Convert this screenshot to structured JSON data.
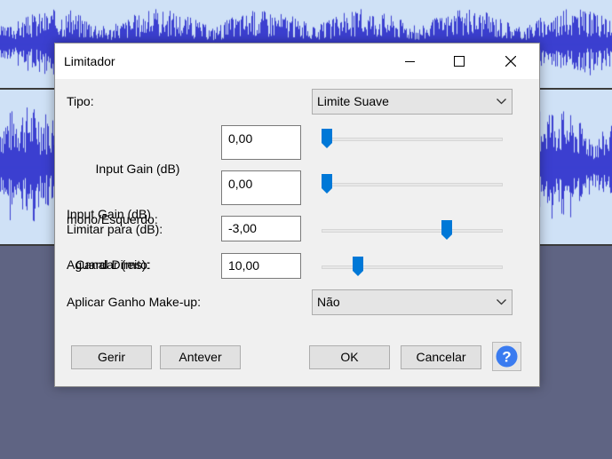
{
  "dialog": {
    "title": "Limitador",
    "fields": {
      "tipo": {
        "label": "Tipo:",
        "value": "Limite Suave"
      },
      "gain_left": {
        "label_line1": "Input Gain (dB)",
        "label_line2": "mono/Esquerdo:",
        "value": "0,00",
        "slider_fraction": 0.03
      },
      "gain_right": {
        "label_line1": "Input Gain (dB)",
        "label_line2": "Canal Direito:",
        "value": "0,00",
        "slider_fraction": 0.03
      },
      "limitar": {
        "label": "Limitar para (dB):",
        "value": "-3,00",
        "slider_fraction": 0.69
      },
      "aguardar": {
        "label": "Aguardar (ms):",
        "value": "10,00",
        "slider_fraction": 0.2
      },
      "makeup": {
        "label": "Aplicar Ganho Make-up:",
        "value": "Não"
      }
    },
    "buttons": {
      "manage": "Gerir",
      "preview": "Antever",
      "ok": "OK",
      "cancel": "Cancelar"
    }
  },
  "colors": {
    "waveform": "#3b3fd0",
    "track_bg": "#cfe1f6",
    "workspace_bg": "#5f6483",
    "slider_thumb": "#0078d7",
    "help_blue": "#3a7bf0"
  },
  "icons": {
    "minimize": "minimize-icon",
    "maximize": "maximize-icon",
    "close": "close-icon",
    "dropdown": "chevron-down-icon",
    "help": "help-icon"
  }
}
